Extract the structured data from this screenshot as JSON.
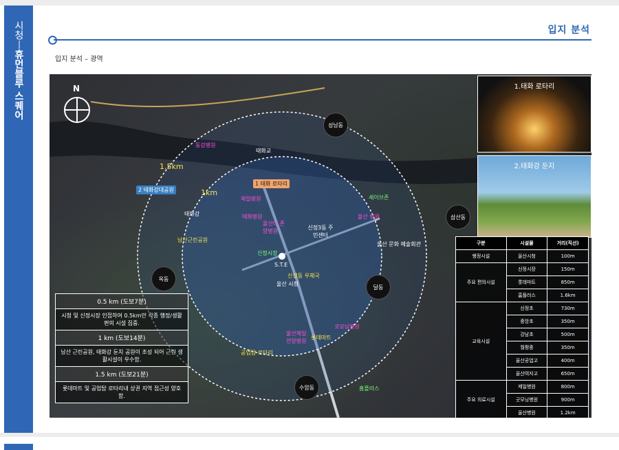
{
  "sidebar": {
    "prefix": "시청",
    "sep": "ㅣ",
    "brand": "휴먼블루 스퀘어"
  },
  "header": {
    "title": "입지 분석",
    "subtitle": "입지 분석 – 광역"
  },
  "map": {
    "compass": "N",
    "site_label": "S.T.E",
    "radius_labels": [
      "1.5km",
      "1km"
    ],
    "markers": [
      {
        "num": "1",
        "text": "태화 로타리",
        "color": "#e8884a"
      },
      {
        "num": "2",
        "text": "태화강대공원",
        "color": "#3a7fc1"
      }
    ],
    "dongs": [
      "성남동",
      "삼산동",
      "달동",
      "옥동",
      "수암동"
    ],
    "labels_pink": [
      "동강병원",
      "제일병원",
      "태화병원",
      "울산대 존양병원",
      "울산 병원",
      "울산제일 전양병원"
    ],
    "labels_white": [
      "태화교",
      "태화강",
      "신정3동 주민센터",
      "울산 문화 예술회관",
      "울산 시청"
    ],
    "labels_yellow": [
      "남산근린공원",
      "신정동 우체국",
      "공업탑 로타리",
      "롯데마트"
    ],
    "labels_green": [
      "신정시장",
      "세이브존",
      "홈플러스"
    ],
    "labels_magenta_extra": [
      "코모님병원"
    ]
  },
  "photos": [
    {
      "caption": "1.태화 로타리"
    },
    {
      "caption": "2.태화강 둔지"
    }
  ],
  "info": [
    {
      "type": "h",
      "text": "0.5 km (도보7분)"
    },
    {
      "type": "d",
      "text": "시청 및 신정시장 인접하여 0.5km안 각종 행정/생활 편의 시설 집중."
    },
    {
      "type": "h",
      "text": "1 km (도보14분)"
    },
    {
      "type": "d",
      "text": "남산 근린공원, 태화강 둔치 공원이 조성 되어 근린 생활시설이 우수함."
    },
    {
      "type": "h",
      "text": "1.5 km (도보21분)"
    },
    {
      "type": "d",
      "text": "롯데마트 및 공업탑 로타리내 상권 지역 접근성 양호함."
    }
  ],
  "facility_table": {
    "headers": [
      "구분",
      "시설물",
      "거리(직선)"
    ],
    "groups": [
      {
        "category": "행정시설",
        "rows": [
          [
            "울산시청",
            "100m"
          ]
        ]
      },
      {
        "category": "주요 편의시설",
        "rows": [
          [
            "신정시장",
            "150m"
          ],
          [
            "롯데마트",
            "850m"
          ],
          [
            "홈플러스",
            "1.6km"
          ]
        ]
      },
      {
        "category": "교육시설",
        "rows": [
          [
            "신정초",
            "730m"
          ],
          [
            "중앙초",
            "350m"
          ],
          [
            "강남초",
            "500m"
          ],
          [
            "월평중",
            "350m"
          ],
          [
            "울산공업고",
            "400m"
          ],
          [
            "울산여자고",
            "650m"
          ]
        ]
      },
      {
        "category": "주요 의료시설",
        "rows": [
          [
            "제일병원",
            "800m"
          ],
          [
            "굿모닝병원",
            "900m"
          ],
          [
            "울산병원",
            "1.2km"
          ]
        ]
      }
    ]
  }
}
